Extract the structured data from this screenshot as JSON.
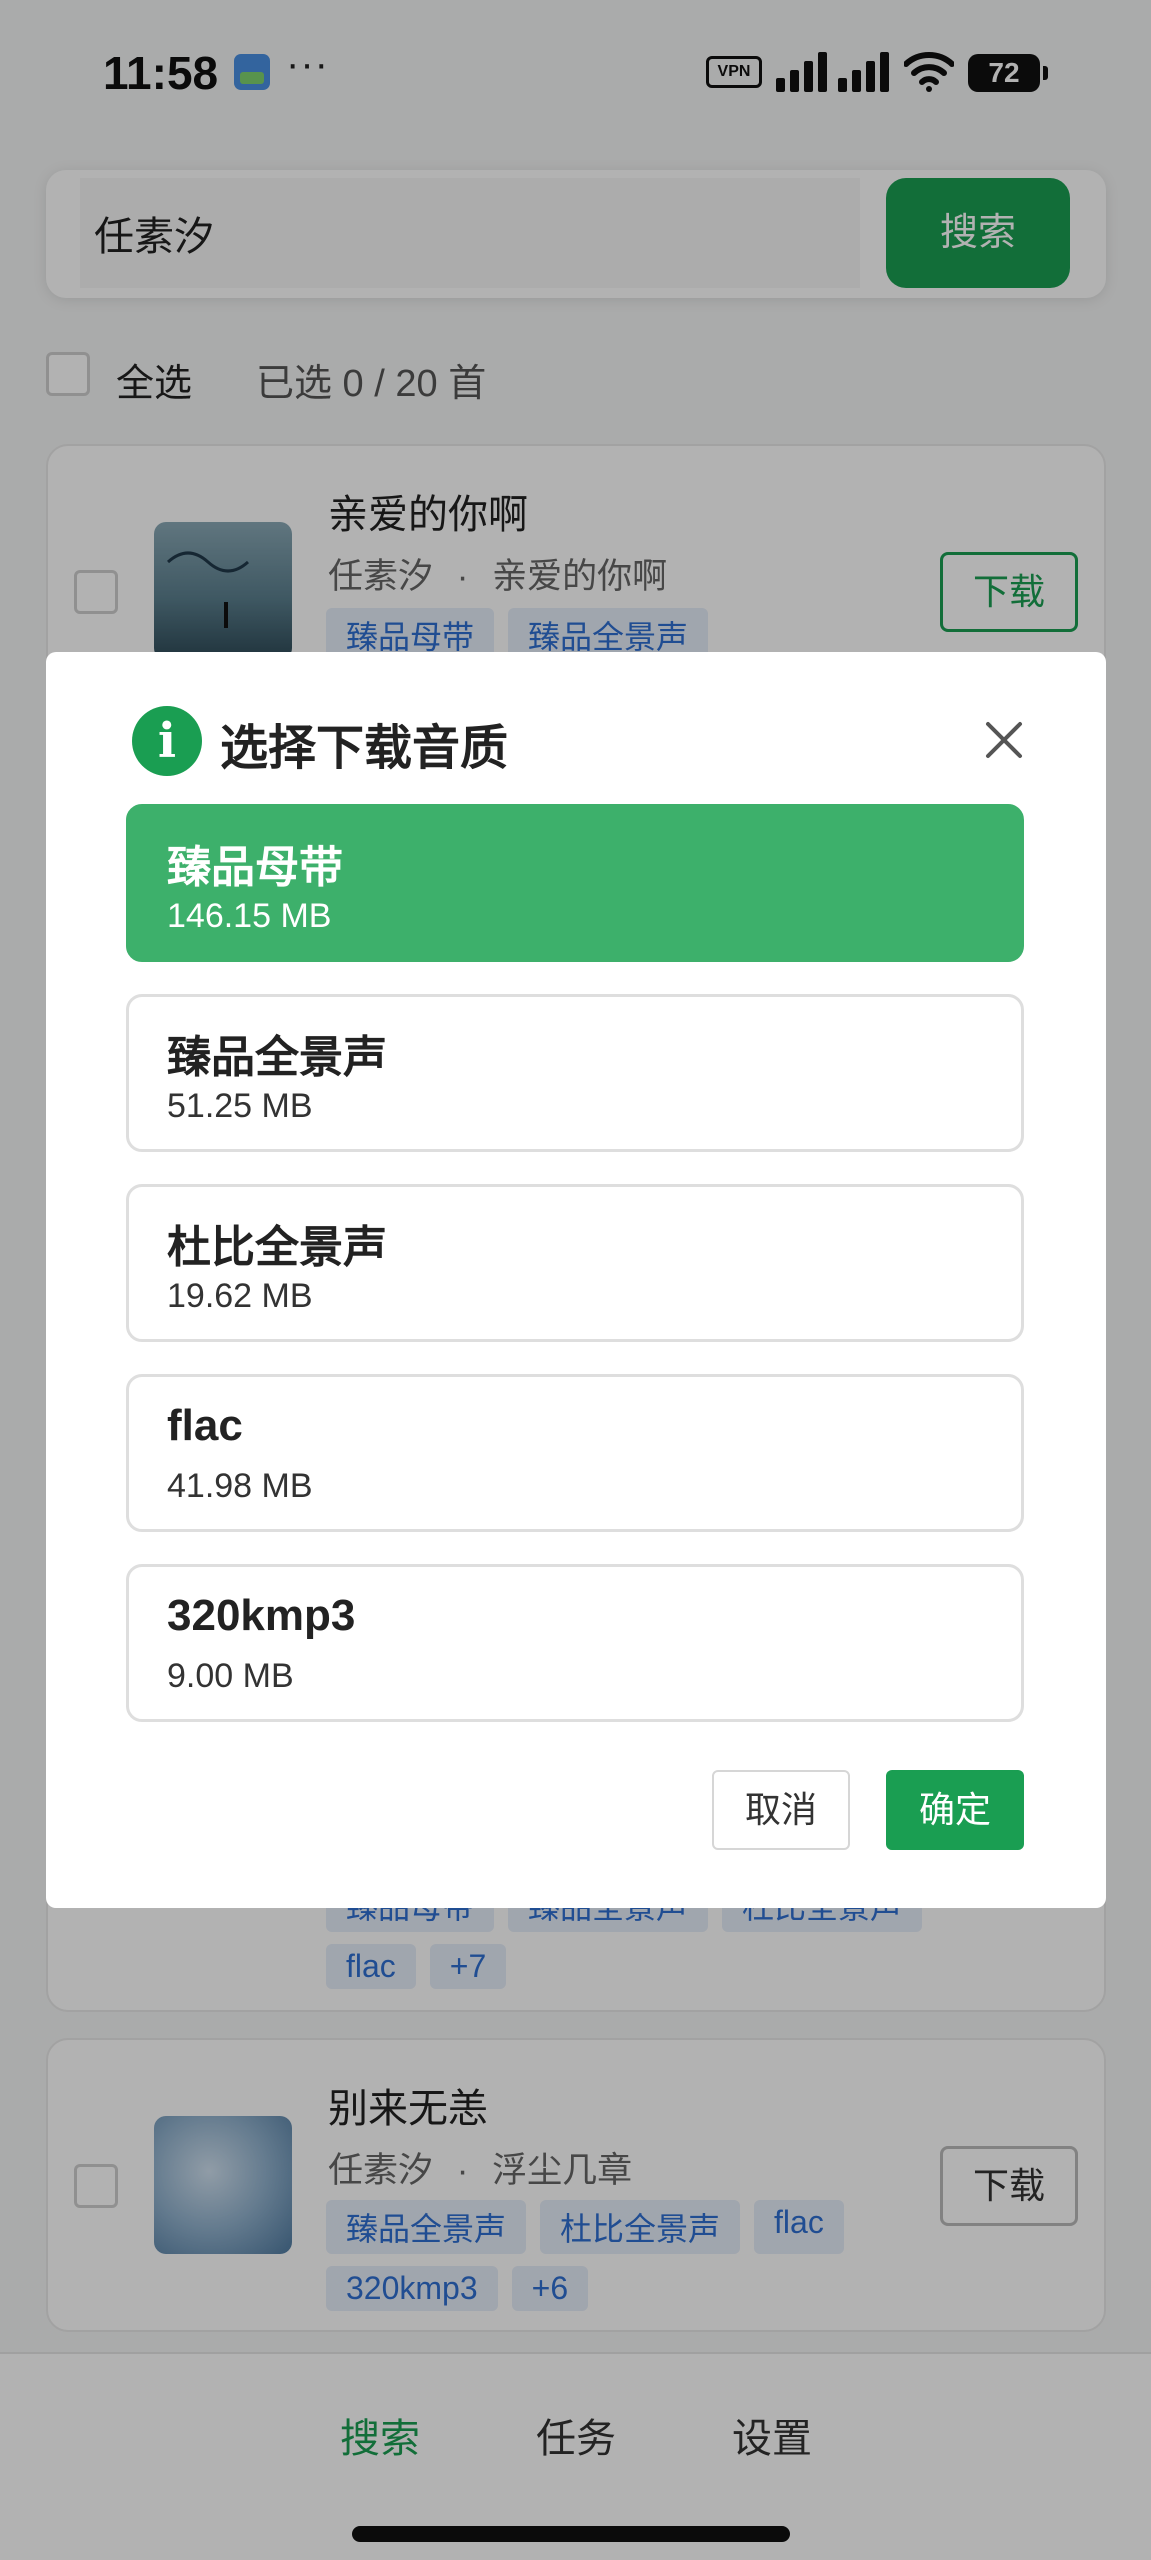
{
  "status_bar": {
    "time": "11:58",
    "dots": "···",
    "vpn": "VPN",
    "battery": "72"
  },
  "search": {
    "value": "任素汐",
    "button_label": "搜索"
  },
  "selection": {
    "select_all_label": "全选",
    "count_text": "已选 0 / 20 首"
  },
  "songs": [
    {
      "title": "亲爱的你啊",
      "artist": "任素汐",
      "separator": "·",
      "album": "亲爱的你啊",
      "tags": [
        "臻品母带",
        "臻品全景声"
      ],
      "download_label": "下载"
    },
    {
      "title": "",
      "artist": "",
      "album": "",
      "tags": [
        "臻品母带",
        "臻品全景声",
        "杜比全景声",
        "flac",
        "+7"
      ]
    },
    {
      "title": "别来无恙",
      "artist": "任素汐",
      "separator": "·",
      "album": "浮尘几章",
      "tags": [
        "臻品全景声",
        "杜比全景声",
        "flac",
        "320kmp3",
        "+6"
      ],
      "download_label": "下载"
    }
  ],
  "bottom_nav": {
    "items": [
      "搜索",
      "任务",
      "设置"
    ],
    "active_index": 0
  },
  "dialog": {
    "title": "选择下载音质",
    "info_icon_glyph": "i",
    "options": [
      {
        "name": "臻品母带",
        "size": "146.15 MB",
        "selected": true
      },
      {
        "name": "臻品全景声",
        "size": "51.25 MB",
        "selected": false
      },
      {
        "name": "杜比全景声",
        "size": "19.62 MB",
        "selected": false
      },
      {
        "name": "flac",
        "size": "41.98 MB",
        "selected": false
      },
      {
        "name": "320kmp3",
        "size": "9.00 MB",
        "selected": false
      }
    ],
    "cancel_label": "取消",
    "confirm_label": "确定"
  },
  "colors": {
    "accent": "#1a9e52",
    "selected_option": "#3db06b",
    "tag_text": "#2f6fd1",
    "tag_bg": "#e6eef9"
  },
  "icons": [
    "gallery-icon",
    "signal-icon",
    "wifi-icon",
    "battery-icon",
    "info-icon",
    "close-icon",
    "checkbox-icon"
  ]
}
